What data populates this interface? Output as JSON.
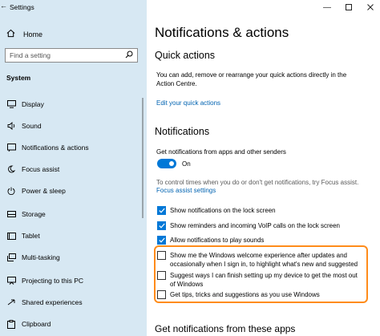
{
  "window": {
    "title": "Settings",
    "controls": [
      "minimize",
      "maximize",
      "close"
    ]
  },
  "sidebar": {
    "home_label": "Home",
    "search_placeholder": "Find a setting",
    "section_label": "System",
    "items": [
      {
        "label": "Display",
        "icon": "display-icon"
      },
      {
        "label": "Sound",
        "icon": "sound-icon"
      },
      {
        "label": "Notifications & actions",
        "icon": "notifications-icon"
      },
      {
        "label": "Focus assist",
        "icon": "moon-icon"
      },
      {
        "label": "Power & sleep",
        "icon": "power-icon"
      },
      {
        "label": "Storage",
        "icon": "storage-icon"
      },
      {
        "label": "Tablet",
        "icon": "tablet-icon"
      },
      {
        "label": "Multi-tasking",
        "icon": "multitasking-icon"
      },
      {
        "label": "Projecting to this PC",
        "icon": "projector-icon"
      },
      {
        "label": "Shared experiences",
        "icon": "shared-icon"
      },
      {
        "label": "Clipboard",
        "icon": "clipboard-icon"
      }
    ]
  },
  "main": {
    "page_title": "Notifications & actions",
    "quick_actions": {
      "heading": "Quick actions",
      "description": "You can add, remove or rearrange your quick actions directly in the Action Centre.",
      "edit_link": "Edit your quick actions"
    },
    "notifications": {
      "heading": "Notifications",
      "toggle_caption": "Get notifications from apps and other senders",
      "toggle_state": "On",
      "focus_note": "To control times when you do or don't get notifications, try Focus assist.",
      "focus_link": "Focus assist settings",
      "options": [
        {
          "label": "Show notifications on the lock screen",
          "checked": true
        },
        {
          "label": "Show reminders and incoming VoIP calls on the lock screen",
          "checked": true
        },
        {
          "label": "Allow notifications to play sounds",
          "checked": true
        },
        {
          "label": "Show me the Windows welcome experience after updates and occasionally when I sign in, to highlight what's new and suggested",
          "checked": false
        },
        {
          "label": "Suggest ways I can finish setting up my device to get the most out of Windows",
          "checked": false
        },
        {
          "label": "Get tips, tricks and suggestions as you use Windows",
          "checked": false
        }
      ]
    },
    "senders_heading": "Get notifications from these apps"
  },
  "colors": {
    "sidebar_bg": "#d7e8f3",
    "accent": "#0078d7",
    "highlight": "#ff8c1a"
  }
}
